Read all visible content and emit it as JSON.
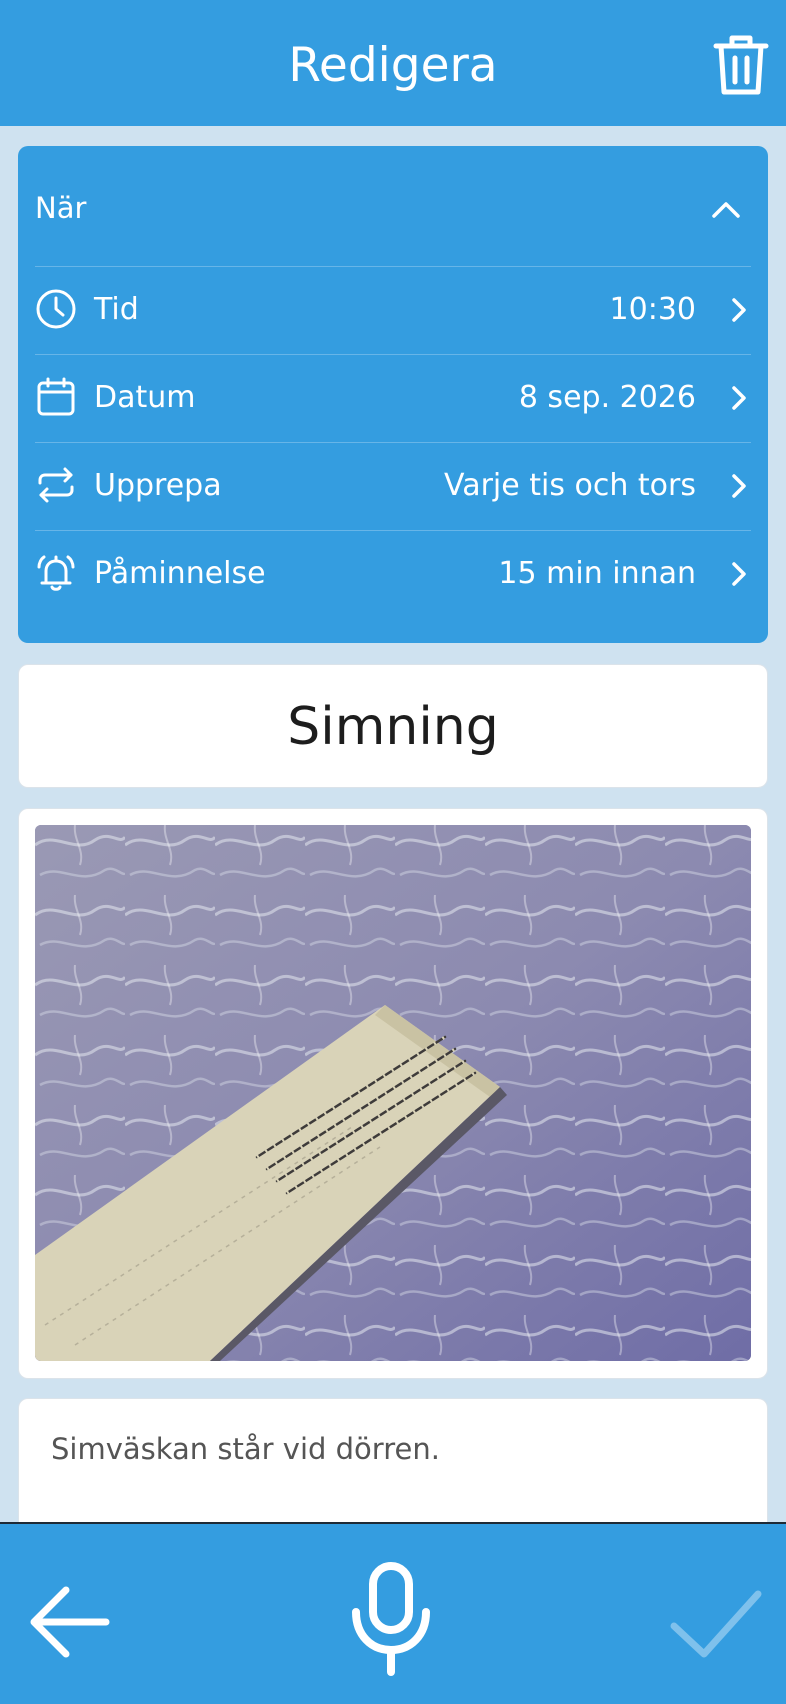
{
  "header": {
    "title": "Redigera",
    "delete_icon": "trash-icon"
  },
  "when": {
    "title": "När",
    "collapse_icon": "chevron-up-icon",
    "rows": [
      {
        "icon": "clock-icon",
        "label": "Tid",
        "value": "10:30"
      },
      {
        "icon": "calendar-icon",
        "label": "Datum",
        "value": "8 sep. 2026"
      },
      {
        "icon": "repeat-icon",
        "label": "Upprepa",
        "value": "Varje tis och tors"
      },
      {
        "icon": "bell-icon",
        "label": "Påminnelse",
        "value": "15 min innan"
      }
    ]
  },
  "activity": {
    "title": "Simning"
  },
  "image": {
    "description_icon": "photo-image"
  },
  "note": {
    "text": "Simväskan står vid dörren."
  },
  "footer": {
    "back_icon": "arrow-left-icon",
    "mic_icon": "microphone-icon",
    "confirm_icon": "checkmark-icon"
  },
  "colors": {
    "primary": "#349de0",
    "background": "#cfe2f0",
    "card": "#ffffff"
  }
}
